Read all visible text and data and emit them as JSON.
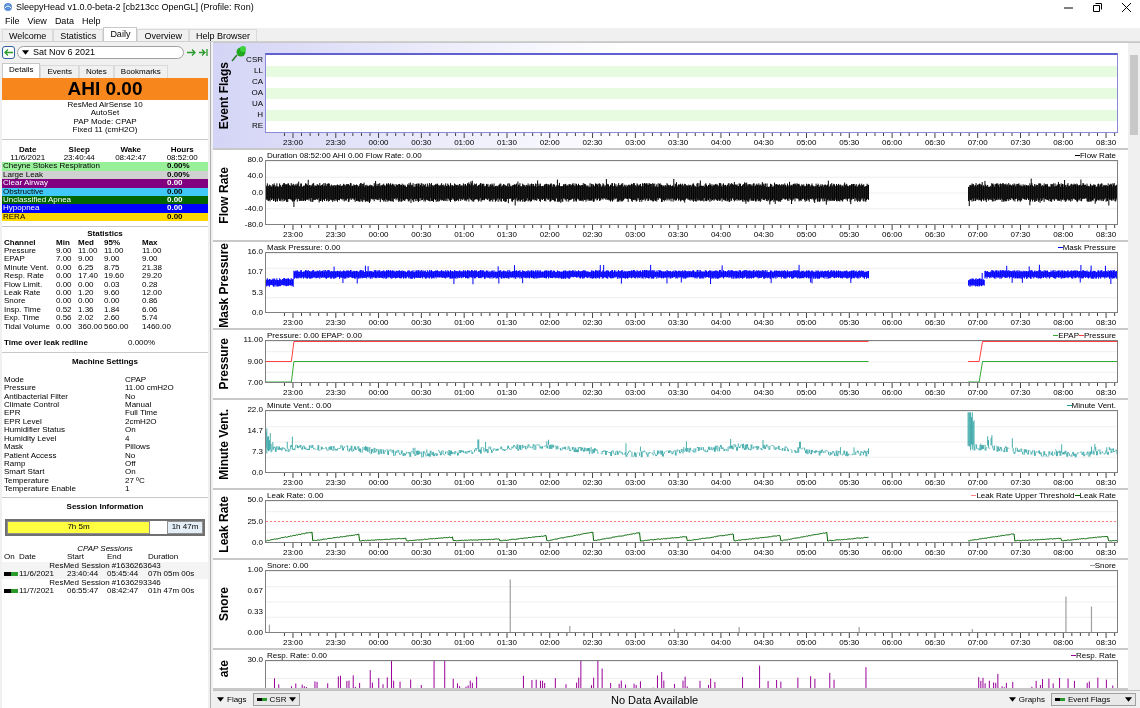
{
  "window": {
    "title": "SleepyHead v1.0.0-beta-2 [cb213cc OpenGL] (Profile: Ron)"
  },
  "menu": [
    "File",
    "View",
    "Data",
    "Help"
  ],
  "tabs": [
    {
      "label": "Welcome",
      "selected": false
    },
    {
      "label": "Statistics",
      "selected": false
    },
    {
      "label": "Daily",
      "selected": true
    },
    {
      "label": "Overview",
      "selected": false
    },
    {
      "label": "Help Browser",
      "selected": false
    }
  ],
  "date_nav": {
    "date": "Sat Nov 6 2021"
  },
  "detail_tabs": [
    {
      "label": "Details",
      "selected": true
    },
    {
      "label": "Events",
      "selected": false
    },
    {
      "label": "Notes",
      "selected": false
    },
    {
      "label": "Bookmarks",
      "selected": false
    }
  ],
  "ahi": "AHI 0.00",
  "machine": [
    "ResMed AirSense 10",
    "AutoSet",
    "PAP Mode: CPAP",
    "Fixed 11 (cmH2O)"
  ],
  "summary": {
    "columns": [
      "Date",
      "Sleep",
      "Wake",
      "Hours"
    ],
    "values": [
      "11/6/2021",
      "23:40:44",
      "08:42:47",
      "08:52:00"
    ]
  },
  "indices": [
    {
      "name": "Cheyne Stokes Respiration",
      "value": "0.00%",
      "color": "#98f098"
    },
    {
      "name": "Large Leak",
      "value": "0.00%",
      "color": "#d0d0d0"
    },
    {
      "name": "Clear Airway",
      "value": "0.00",
      "color": "#800080"
    },
    {
      "name": "Obstructive",
      "value": "0.00",
      "color": "#40c8f8"
    },
    {
      "name": "Unclassified Apnea",
      "value": "0.00",
      "color": "#006400"
    },
    {
      "name": "Hypopnea",
      "value": "0.00",
      "color": "#0000ff"
    },
    {
      "name": "RERA",
      "value": "0.00",
      "color": "#ffd700"
    }
  ],
  "statistics": {
    "title": "Statistics",
    "columns": [
      "Channel",
      "Min",
      "Med",
      "95%",
      "Max"
    ],
    "rows": [
      [
        "Pressure",
        "9.00",
        "11.00",
        "11.00",
        "11.00"
      ],
      [
        "EPAP",
        "7.00",
        "9.00",
        "9.00",
        "9.00"
      ],
      [
        "Minute Vent.",
        "0.00",
        "6.25",
        "8.75",
        "21.38"
      ],
      [
        "Resp. Rate",
        "0.00",
        "17.40",
        "19.60",
        "29.20"
      ],
      [
        "Flow Limit.",
        "0.00",
        "0.00",
        "0.03",
        "0.28"
      ],
      [
        "Leak Rate",
        "0.00",
        "1.20",
        "9.60",
        "12.00"
      ],
      [
        "Snore",
        "0.00",
        "0.00",
        "0.00",
        "0.86"
      ],
      [
        "Insp. Time",
        "0.52",
        "1.36",
        "1.84",
        "6.06"
      ],
      [
        "Exp. Time",
        "0.56",
        "2.02",
        "2.60",
        "5.74"
      ],
      [
        "Tidal Volume",
        "0.00",
        "360.00",
        "560.00",
        "1460.00"
      ]
    ]
  },
  "leak_redline": {
    "label": "Time over leak redline",
    "value": "0.000%"
  },
  "machine_settings": {
    "title": "Machine Settings",
    "rows": [
      [
        "Mode",
        "CPAP"
      ],
      [
        "Pressure",
        "11.00 cmH2O"
      ],
      [
        "Antibacterial Filter",
        "No"
      ],
      [
        "Climate Control",
        "Manual"
      ],
      [
        "EPR",
        "Full Time"
      ],
      [
        "EPR Level",
        "2cmH2O"
      ],
      [
        "Humidifier Status",
        "On"
      ],
      [
        "Humidity Level",
        "4"
      ],
      [
        "Mask",
        "Pillows"
      ],
      [
        "Patient Access",
        "No"
      ],
      [
        "Ramp",
        "Off"
      ],
      [
        "Smart Start",
        "On"
      ],
      [
        "Temperature",
        "27 ºC"
      ],
      [
        "Temperature Enable",
        "1"
      ]
    ]
  },
  "session_info": {
    "title": "Session Information",
    "segments": [
      {
        "label": "7h 5m",
        "color": "#ffff40"
      },
      {
        "label": "1h 47m",
        "color": "#e4eef6"
      }
    ]
  },
  "cpap_sessions": {
    "title": "CPAP Sessions",
    "columns": [
      "On",
      "Date",
      "Start",
      "End",
      "Duration"
    ],
    "sessions": [
      {
        "name": "ResMed Session #1636263643",
        "on": true,
        "date": "11/6/2021",
        "start": "23:40:44",
        "end": "05:45:44",
        "duration": "07h 05m 00s"
      },
      {
        "name": "ResMed Session #1636293346",
        "on": true,
        "date": "11/7/2021",
        "start": "06:55:47",
        "end": "08:42:47",
        "duration": "01h 47m 00s"
      }
    ]
  },
  "graphs": [
    {
      "kind": "flags",
      "label": "Event Flags",
      "flags": [
        "CSR",
        "LL",
        "CA",
        "OA",
        "UA",
        "H",
        "RE"
      ],
      "x_ticks": [
        "23:00",
        "23:30",
        "00:00",
        "00:30",
        "01:00",
        "01:30",
        "02:00",
        "02:30",
        "03:00",
        "03:30",
        "04:00",
        "04:30",
        "05:00",
        "05:30",
        "06:00",
        "06:30",
        "07:00",
        "07:30",
        "08:00",
        "08:30"
      ]
    },
    {
      "kind": "noise",
      "label": "Flow Rate",
      "title": "Duration 08:52:00 AHI 0.00 Flow Rate: 0.00",
      "legend": [
        {
          "label": "Flow Rate",
          "color": "#000000"
        }
      ],
      "y_ticks": [
        "80.0",
        "40.0",
        "0.0",
        "-40.0",
        "-80.0"
      ],
      "x_ticks": [
        "23:00",
        "23:30",
        "00:00",
        "00:30",
        "01:00",
        "01:30",
        "02:00",
        "02:30",
        "03:00",
        "03:30",
        "04:00",
        "04:30",
        "05:00",
        "05:30",
        "06:00",
        "06:30",
        "07:00",
        "07:30",
        "08:00",
        "08:30"
      ]
    },
    {
      "kind": "band",
      "label": "Mask Pressure",
      "title": "Mask Pressure: 0.00",
      "legend": [
        {
          "label": "Mask Pressure",
          "color": "#0000ff"
        }
      ],
      "y_ticks": [
        "16.0",
        "10.7",
        "5.3",
        "0.0"
      ],
      "x_ticks": [
        "23:00",
        "23:30",
        "00:00",
        "00:30",
        "01:00",
        "01:30",
        "02:00",
        "02:30",
        "03:00",
        "03:30",
        "04:00",
        "04:30",
        "05:00",
        "05:30",
        "06:00",
        "06:30",
        "07:00",
        "07:30",
        "08:00",
        "08:30"
      ]
    },
    {
      "kind": "step",
      "label": "Pressure",
      "title": "Pressure: 0.00 EPAP: 0.00",
      "legend": [
        {
          "label": "EPAP",
          "color": "#33aa33"
        },
        {
          "label": "Pressure",
          "color": "#ff4040"
        }
      ],
      "y_ticks": [
        "11.00",
        "9.00",
        "7.00"
      ],
      "x_ticks": [
        "23:00",
        "23:30",
        "00:00",
        "00:30",
        "01:00",
        "01:30",
        "02:00",
        "02:30",
        "03:00",
        "03:30",
        "04:00",
        "04:30",
        "05:00",
        "05:30",
        "06:00",
        "06:30",
        "07:00",
        "07:30",
        "08:00",
        "08:30"
      ]
    },
    {
      "kind": "trace",
      "label": "Minute Vent.",
      "title": "Minute Vent.: 0.00",
      "legend": [
        {
          "label": "Minute Vent.",
          "color": "#1a9999"
        }
      ],
      "y_ticks": [
        "22.0",
        "14.7",
        "7.3",
        "0.0"
      ],
      "x_ticks": [
        "23:00",
        "23:30",
        "00:00",
        "00:30",
        "01:00",
        "01:30",
        "02:00",
        "02:30",
        "03:00",
        "03:30",
        "04:00",
        "04:30",
        "05:00",
        "05:30",
        "06:00",
        "06:30",
        "07:00",
        "07:30",
        "08:00",
        "08:30"
      ]
    },
    {
      "kind": "leak",
      "label": "Leak Rate",
      "title": "Leak Rate: 0.00",
      "legend": [
        {
          "label": "Leak Rate Upper Threshold",
          "color": "#ff8080"
        },
        {
          "label": "Leak Rate",
          "color": "#006400"
        }
      ],
      "y_ticks": [
        "50.0",
        "25.0",
        "0.0"
      ],
      "x_ticks": [
        "23:00",
        "23:30",
        "00:00",
        "00:30",
        "01:00",
        "01:30",
        "02:00",
        "02:30",
        "03:00",
        "03:30",
        "04:00",
        "04:30",
        "05:00",
        "05:30",
        "06:00",
        "06:30",
        "07:00",
        "07:30",
        "08:00",
        "08:30"
      ]
    },
    {
      "kind": "spikes",
      "label": "Snore",
      "title": "Snore: 0.00",
      "legend": [
        {
          "label": "Snore",
          "color": "#a0a0a0"
        }
      ],
      "y_ticks": [
        "1.00",
        "0.67",
        "0.33",
        "0.00"
      ],
      "x_ticks": [
        "23:00",
        "23:30",
        "00:00",
        "00:30",
        "01:00",
        "01:30",
        "02:00",
        "02:30",
        "03:00",
        "03:30",
        "04:00",
        "04:30",
        "05:00",
        "05:30",
        "06:00",
        "06:30",
        "07:00",
        "07:30",
        "08:00",
        "08:30"
      ]
    },
    {
      "kind": "bars",
      "label": "ate",
      "title": "Resp. Rate: 0.00",
      "legend": [
        {
          "label": "Resp. Rate",
          "color": "#990099"
        }
      ],
      "y_ticks": [
        "30.0"
      ]
    }
  ],
  "bottom_bar": {
    "flags_button": "Flags",
    "flags_combo": "CSR",
    "message": "No Data Available",
    "graphs_button": "Graphs",
    "graphs_combo": "Event Flags"
  }
}
